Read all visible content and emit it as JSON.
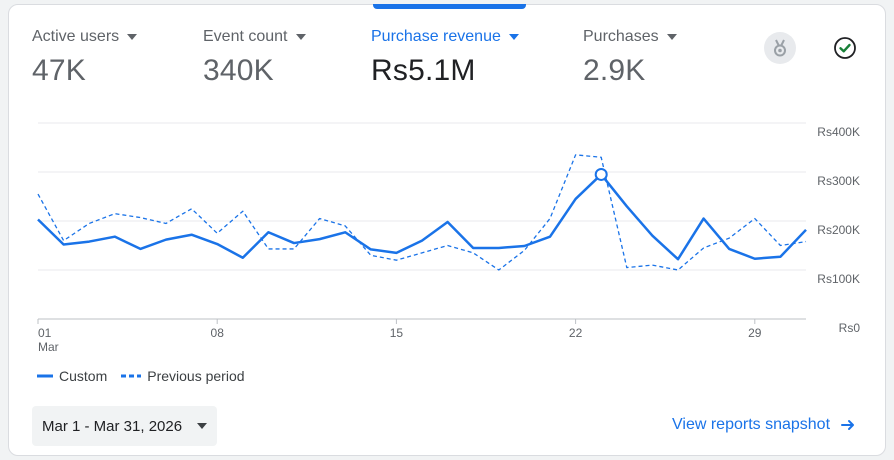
{
  "metrics": [
    {
      "label": "Active users",
      "value": "47K"
    },
    {
      "label": "Event count",
      "value": "340K"
    },
    {
      "label": "Purchase revenue",
      "value": "Rs5.1M"
    },
    {
      "label": "Purchases",
      "value": "2.9K"
    }
  ],
  "icons": {
    "insights": "medal-icon",
    "status": "check-circle-icon"
  },
  "colors": {
    "accent": "#1a73e8",
    "grid": "#e8eaed",
    "text": "#5f6368",
    "status_green": "#188038"
  },
  "legend": {
    "custom": "Custom",
    "previous": "Previous period"
  },
  "date_range": "Mar 1 - Mar 31, 2026",
  "snapshot_link": "View reports snapshot",
  "chart_data": {
    "type": "line",
    "x_ticks": [
      {
        "day": 1,
        "label": "01",
        "sublabel": "Mar"
      },
      {
        "day": 8,
        "label": "08"
      },
      {
        "day": 15,
        "label": "15"
      },
      {
        "day": 22,
        "label": "22"
      },
      {
        "day": 29,
        "label": "29"
      }
    ],
    "y_ticks": [
      "Rs0",
      "Rs100K",
      "Rs200K",
      "Rs300K",
      "Rs400K"
    ],
    "ylim": [
      0,
      400000
    ],
    "xlim": [
      1,
      31
    ],
    "grid": true,
    "legend_position": "bottom-left",
    "highlight_day": 23,
    "series": [
      {
        "name": "Custom",
        "style": "solid",
        "values": [
          203000,
          152000,
          158000,
          168000,
          143000,
          162000,
          172000,
          153000,
          125000,
          177000,
          155000,
          163000,
          177000,
          142000,
          135000,
          160000,
          198000,
          145000,
          145000,
          149000,
          168000,
          245000,
          295000,
          230000,
          170000,
          122000,
          205000,
          143000,
          123000,
          127000,
          182000
        ]
      },
      {
        "name": "Previous period",
        "style": "dashed",
        "values": [
          255000,
          160000,
          195000,
          215000,
          207000,
          195000,
          225000,
          175000,
          220000,
          143000,
          143000,
          205000,
          190000,
          130000,
          120000,
          135000,
          150000,
          135000,
          100000,
          140000,
          205000,
          335000,
          330000,
          105000,
          110000,
          100000,
          145000,
          165000,
          205000,
          150000,
          158000
        ]
      }
    ]
  }
}
